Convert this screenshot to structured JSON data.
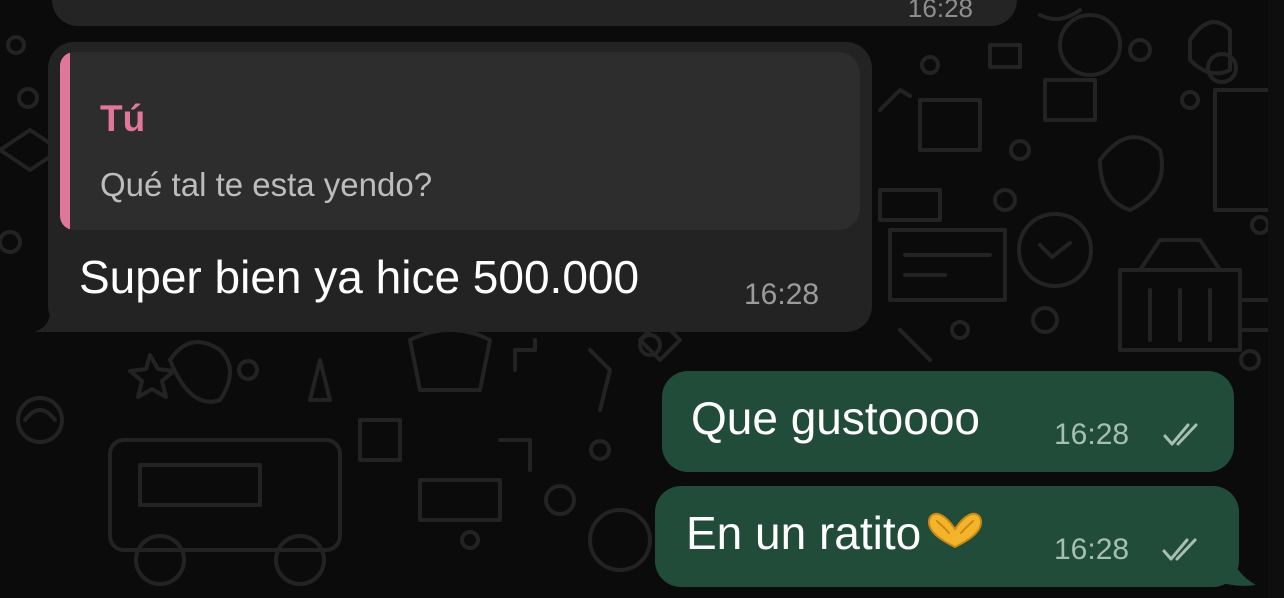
{
  "previous_message": {
    "time": "16:28"
  },
  "incoming_message": {
    "quote": {
      "author": "Tú",
      "text": "Qué tal te esta yendo?"
    },
    "text": "Super bien ya hice 500.000",
    "time": "16:28"
  },
  "outgoing_messages": [
    {
      "text": "Que gustoooo",
      "time": "16:28",
      "status_icon": "double-check-icon"
    },
    {
      "text": "En un ratito",
      "emoji": "heart-hands-emoji",
      "time": "16:28",
      "status_icon": "double-check-icon"
    }
  ],
  "colors": {
    "background": "#0b0b0b",
    "incoming_bubble": "#232323",
    "quote_background": "#2d2d2d",
    "quote_accent": "#e2779c",
    "outgoing_bubble": "#214c39",
    "timestamp": "#9b9b9b"
  }
}
